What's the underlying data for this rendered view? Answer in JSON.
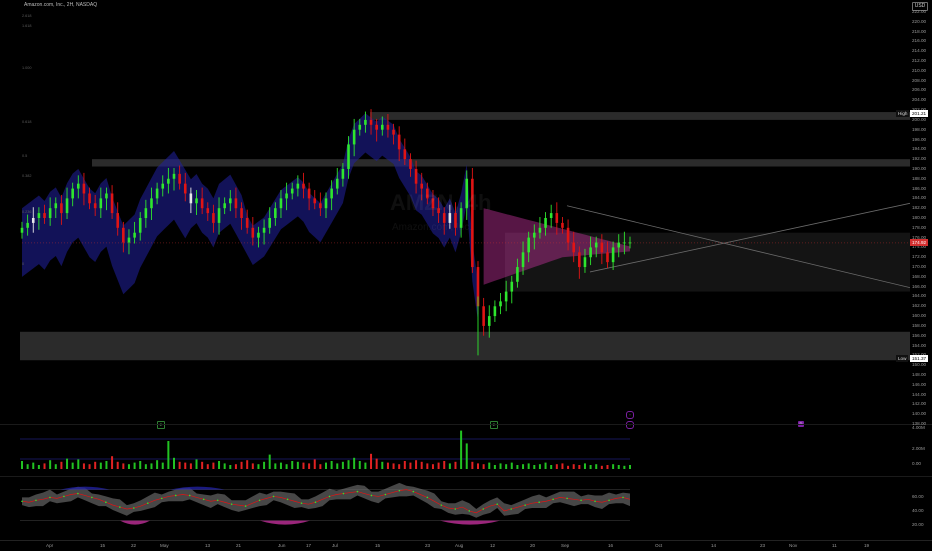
{
  "header": {
    "title": "Amazon.com, Inc., 2H, NASDAQ",
    "currency": "USD",
    "watermark_ticker": "AMZN, 4h",
    "watermark_name": "Amazon.com, Inc."
  },
  "colors": {
    "up": "#2ee62e",
    "down": "#e01414",
    "neutral": "#e8e8e8",
    "volume_up": "#22c322",
    "volume_down": "#e22222",
    "ema_cloud": "#2020a0",
    "pink_cloud": "#c0309a",
    "zone": "#3a3a3a",
    "trendline": "#6a6a6a",
    "tag_high": "#ffffff",
    "tag_close": "#d32f2f",
    "tag_low": "#ffffff",
    "marker_green": "#1b5e20",
    "marker_purple": "#7b1fa2"
  },
  "price_axis": {
    "min": 138,
    "max": 222,
    "step": 2,
    "labels": [
      "222.00",
      "220.00",
      "218.00",
      "216.00",
      "214.00",
      "212.00",
      "210.00",
      "208.00",
      "206.00",
      "204.00",
      "202.00",
      "200.00",
      "198.00",
      "196.00",
      "194.00",
      "192.00",
      "190.00",
      "188.00",
      "186.00",
      "184.00",
      "182.00",
      "180.00",
      "178.00",
      "176.00",
      "174.00",
      "172.00",
      "170.00",
      "168.00",
      "166.00",
      "164.00",
      "162.00",
      "160.00",
      "158.00",
      "156.00",
      "154.00",
      "152.00",
      "150.00",
      "148.00",
      "146.00",
      "144.00",
      "142.00",
      "140.00",
      "138.00"
    ],
    "high_tag": {
      "label": "High",
      "value": "201.21"
    },
    "close_tag": {
      "value": "174.92"
    },
    "low_tag": {
      "label": "Low",
      "value": "151.37"
    }
  },
  "left_scale_labels": [
    "2.618",
    "1.618",
    "1.000",
    "0.618",
    "0.5",
    "0.382",
    "0.236",
    "0"
  ],
  "volume_axis": {
    "labels": [
      "4.00M",
      "2.00M",
      "0.00"
    ]
  },
  "osc_axis": {
    "labels": [
      "60.00",
      "40.00",
      "20.00"
    ]
  },
  "time_axis": {
    "labels": [
      "Apr",
      "15",
      "22",
      "May",
      "13",
      "21",
      "Jun",
      "17",
      "Jul",
      "15",
      "23",
      "Aug",
      "12",
      "20",
      "Sep",
      "16",
      "Oct",
      "14",
      "23",
      "Nov",
      "11",
      "19"
    ]
  },
  "chart_data": {
    "type": "candlestick",
    "symbol": "AMZN",
    "range_high": 201.21,
    "range_low": 151.37,
    "last_close": 174.92,
    "zones": [
      {
        "from": 200.0,
        "to": 201.6
      },
      {
        "from": 190.5,
        "to": 192.0
      },
      {
        "from": 151.0,
        "to": 156.8
      },
      {
        "from": 165.0,
        "to": 177.0
      }
    ],
    "trendlines": [
      {
        "from": {
          "date": "Aug 20",
          "price": 182.0
        },
        "to": {
          "date": "Nov 19",
          "price": 165.8
        }
      },
      {
        "from": {
          "date": "Sep 1",
          "price": 169.0
        },
        "to": {
          "date": "Nov 19",
          "price": 183.0
        }
      }
    ],
    "candles_close": [
      178,
      179,
      180,
      181,
      180,
      182,
      183,
      181,
      184,
      186,
      187,
      185,
      183,
      182,
      184,
      185,
      181,
      178,
      175,
      176,
      177,
      180,
      182,
      184,
      186,
      187,
      188,
      189,
      187,
      185,
      183,
      184,
      182,
      181,
      179,
      182,
      183,
      184,
      182,
      180,
      178,
      176,
      177,
      178,
      180,
      182,
      184,
      185,
      186,
      187,
      186,
      184,
      183,
      182,
      184,
      186,
      188,
      190,
      195,
      198,
      199,
      200,
      199,
      198,
      199,
      198,
      197,
      194,
      192,
      190,
      187,
      186,
      184,
      182,
      181,
      179,
      181,
      178,
      182,
      188,
      170,
      162,
      158,
      160,
      162,
      163,
      165,
      167,
      170,
      173,
      176,
      177,
      178,
      180,
      181,
      179,
      178,
      175,
      173,
      170,
      172,
      174,
      175,
      173,
      171,
      174,
      175,
      175,
      175
    ]
  },
  "volume_data": {
    "values": [
      1.0,
      0.6,
      0.8,
      0.5,
      0.7,
      1.1,
      0.6,
      0.9,
      1.3,
      0.8,
      1.2,
      0.7,
      0.6,
      0.9,
      0.8,
      1.0,
      1.6,
      0.9,
      0.7,
      0.6,
      0.8,
      1.0,
      0.6,
      0.7,
      1.1,
      0.8,
      3.5,
      1.4,
      0.9,
      0.8,
      0.7,
      1.2,
      0.9,
      0.6,
      0.8,
      1.0,
      0.7,
      0.5,
      0.6,
      0.9,
      1.1,
      0.7,
      0.6,
      0.9,
      1.8,
      0.7,
      0.8,
      0.6,
      1.0,
      0.9,
      0.8,
      0.7,
      1.2,
      0.6,
      0.8,
      1.0,
      0.7,
      0.9,
      1.1,
      1.4,
      1.0,
      0.8,
      1.9,
      1.3,
      0.9,
      0.8,
      0.7,
      0.6,
      1.0,
      0.8,
      1.1,
      0.9,
      0.7,
      0.6,
      0.8,
      1.0,
      0.7,
      0.9,
      4.8,
      3.2,
      0.9,
      0.7,
      0.6,
      0.8,
      0.5,
      0.7,
      0.6,
      0.8,
      0.5,
      0.6,
      0.7,
      0.5,
      0.6,
      0.8,
      0.5,
      0.6,
      0.7,
      0.4,
      0.6,
      0.5,
      0.7,
      0.5,
      0.6,
      0.4,
      0.5,
      0.6,
      0.5,
      0.4,
      0.5
    ],
    "max": 5.0
  },
  "oscillator_data": {
    "values": [
      48,
      47,
      49,
      50,
      52,
      51,
      53,
      55,
      56,
      54,
      52,
      50,
      47,
      44,
      42,
      40,
      41,
      43,
      46,
      49,
      51,
      53,
      54,
      55,
      54,
      52,
      50,
      48,
      49,
      47,
      45,
      44,
      43,
      46,
      49,
      51,
      53,
      52,
      50,
      48,
      46,
      45,
      47,
      50,
      53,
      55,
      56,
      57,
      58,
      56,
      54,
      53,
      55,
      57,
      59,
      60,
      58,
      55,
      52,
      48,
      44,
      41,
      40,
      42,
      38,
      36,
      40,
      43,
      45,
      38,
      40,
      42,
      44,
      46,
      47,
      48,
      50,
      52,
      51,
      50,
      49,
      50,
      48,
      47,
      49,
      51,
      52,
      50
    ],
    "upper_band": 60,
    "lower_band": 28
  }
}
